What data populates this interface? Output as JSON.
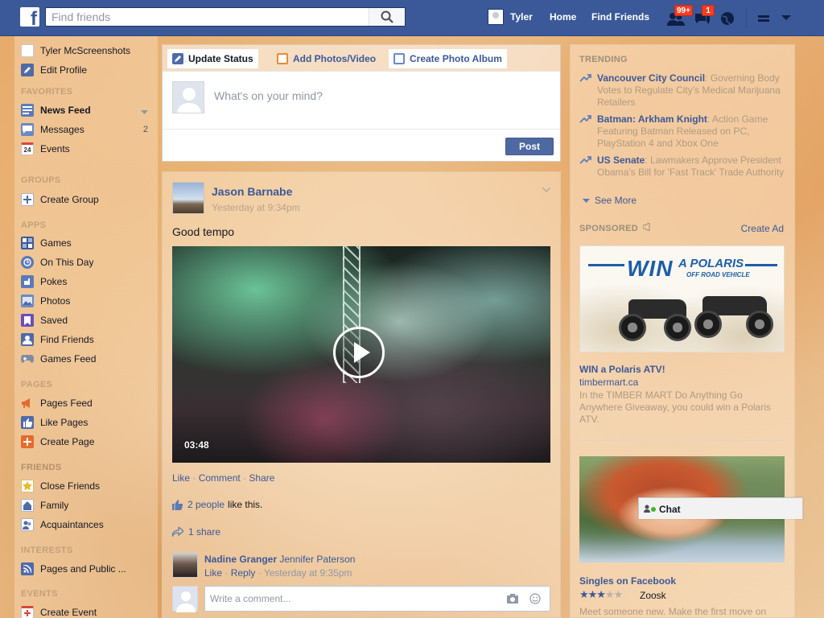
{
  "topbar": {
    "logo": "f",
    "search_placeholder": "Find friends",
    "profile_name": "Tyler",
    "links": [
      "Home",
      "Find Friends"
    ],
    "friend_requests_badge": "99+",
    "messages_badge": "1",
    "bar_color": "#3b5998"
  },
  "sidebar": {
    "profile": [
      {
        "label": "Tyler McScreenshots",
        "icon": "profile-avatar-icon"
      },
      {
        "label": "Edit Profile",
        "icon": "pencil-icon"
      }
    ],
    "sections": {
      "favorites": "FAVORITES",
      "groups": "GROUPS",
      "apps": "APPS",
      "pages": "PAGES",
      "friends": "FRIENDS",
      "interests": "INTERESTS",
      "events": "EVENTS"
    },
    "favorites": [
      {
        "label": "News Feed",
        "icon": "news-feed-icon"
      },
      {
        "label": "Messages",
        "icon": "messages-icon",
        "count": "2"
      },
      {
        "label": "Events",
        "icon": "calendar-icon",
        "icon_text": "24"
      }
    ],
    "groups": [
      {
        "label": "Create Group",
        "icon": "plus-icon"
      }
    ],
    "apps": [
      {
        "label": "Games",
        "icon": "games-icon"
      },
      {
        "label": "On This Day",
        "icon": "clock-icon"
      },
      {
        "label": "Pokes",
        "icon": "poke-icon"
      },
      {
        "label": "Photos",
        "icon": "photos-icon"
      },
      {
        "label": "Saved",
        "icon": "bookmark-icon"
      },
      {
        "label": "Find Friends",
        "icon": "find-friends-icon"
      },
      {
        "label": "Games Feed",
        "icon": "gamepad-icon"
      }
    ],
    "pages": [
      {
        "label": "Pages Feed",
        "icon": "megaphone-icon"
      },
      {
        "label": "Like Pages",
        "icon": "thumbs-up-icon"
      },
      {
        "label": "Create Page",
        "icon": "plus-icon"
      }
    ],
    "friends": [
      {
        "label": "Close Friends",
        "icon": "star-icon"
      },
      {
        "label": "Family",
        "icon": "family-icon"
      },
      {
        "label": "Acquaintances",
        "icon": "acquaintances-icon"
      }
    ],
    "interests": [
      {
        "label": "Pages and Public ...",
        "icon": "rss-icon"
      }
    ],
    "events": [
      {
        "label": "Create Event",
        "icon": "plus-icon"
      }
    ]
  },
  "composer": {
    "tabs": [
      "Update Status",
      "Add Photos/Video",
      "Create Photo Album"
    ],
    "placeholder": "What's on your mind?",
    "post_label": "Post"
  },
  "story": {
    "author": "Jason Barnabe",
    "time": "Yesterday at 9:34pm",
    "text": "Good tempo",
    "video_duration": "03:48",
    "actions": [
      "Like",
      "Comment",
      "Share"
    ],
    "likes_link": "2 people",
    "likes_suffix": "like this.",
    "shares": "1 share",
    "comment": {
      "author_1": "Nadine Granger",
      "author_2": "Jennifer Paterson",
      "like": "Like",
      "reply": "Reply",
      "time": "Yesterday at 9:35pm"
    },
    "comment_placeholder": "Write a comment..."
  },
  "right": {
    "trending_header": "TRENDING",
    "trending": [
      {
        "title": "Vancouver City Council",
        "text": ": Governing Body Votes to Regulate City's Medical Marijuana Retailers"
      },
      {
        "title": "Batman: Arkham Knight",
        "text": ": Action Game Featuring Batman Released on PC, PlayStation 4 and Xbox One"
      },
      {
        "title": "US Senate",
        "text": ": Lawmakers Approve President Obama's Bill for 'Fast Track' Trade Authority"
      }
    ],
    "see_more": "See More",
    "sponsored_header": "SPONSORED",
    "create_ad": "Create Ad",
    "ad1": {
      "banner_win": "WIN",
      "banner_brand": "A POLARIS",
      "banner_sub": "OFF ROAD VEHICLE",
      "title": "WIN a Polaris ATV!",
      "domain": "timbermart.ca",
      "desc": "In the TIMBER MART Do Anything Go Anywhere Giveaway, you could win a Polaris ATV."
    },
    "ad2": {
      "title": "Singles on Facebook",
      "rating": 3,
      "brand": "Zoosk",
      "desc": "Meet someone new. Make the first move on"
    }
  },
  "chat": {
    "label": "Chat"
  }
}
